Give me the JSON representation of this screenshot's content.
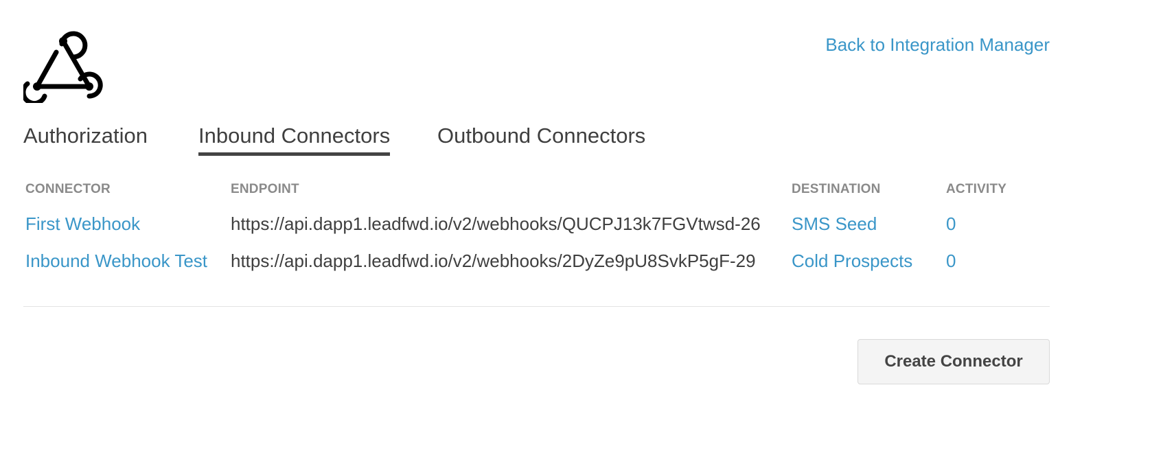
{
  "header": {
    "logo_icon": "webhook-icon",
    "back_link": "Back to Integration Manager"
  },
  "tabs": [
    {
      "label": "Authorization",
      "active": false
    },
    {
      "label": "Inbound Connectors",
      "active": true
    },
    {
      "label": "Outbound Connectors",
      "active": false
    }
  ],
  "table": {
    "columns": [
      "CONNECTOR",
      "ENDPOINT",
      "DESTINATION",
      "ACTIVITY"
    ],
    "rows": [
      {
        "connector": "First Webhook",
        "endpoint": "https://api.dapp1.leadfwd.io/v2/webhooks/QUCPJ13k7FGVtwsd-26",
        "destination": "SMS Seed",
        "activity": "0"
      },
      {
        "connector": "Inbound Webhook Test",
        "endpoint": "https://api.dapp1.leadfwd.io/v2/webhooks/2DyZe9pU8SvkP5gF-29",
        "destination": "Cold Prospects",
        "activity": "0"
      }
    ]
  },
  "actions": {
    "create_label": "Create Connector"
  },
  "colors": {
    "link": "#3a96c8",
    "text": "#3f3f3f",
    "header_text": "#8a8a8a"
  }
}
